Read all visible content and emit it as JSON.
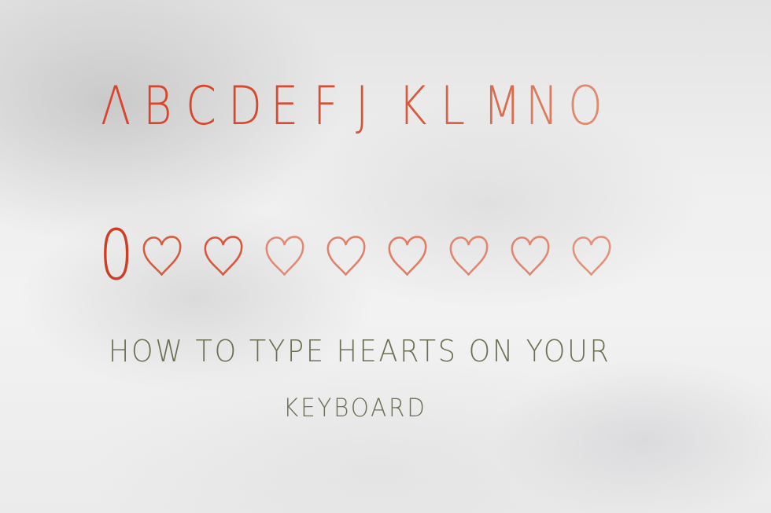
{
  "alphabet": {
    "letters": [
      "Λ",
      "B",
      "C",
      "D",
      "E",
      "F",
      "J",
      "K",
      "L",
      "M",
      "N",
      "O"
    ],
    "colors": [
      "#d9442a",
      "#d9442a",
      "#d9452b",
      "#d8482d",
      "#d94b30",
      "#d74e33",
      "#d65436",
      "#d65a3b",
      "#d76343",
      "#da6c4d",
      "#dc7a5c",
      "#df8a6e"
    ]
  },
  "hearts_row": {
    "leading_glyph": "0",
    "leading_color": "#cf3d25",
    "heart_colors": [
      "#d65a3c",
      "#d9563a",
      "#e08a72",
      "#df8168",
      "#e07c62",
      "#e0866c",
      "#e0866c",
      "#e39279"
    ]
  },
  "caption": {
    "line1": "HOW TO TYPE HEARTS ON YOUR",
    "line2": "KEYBOARD"
  }
}
